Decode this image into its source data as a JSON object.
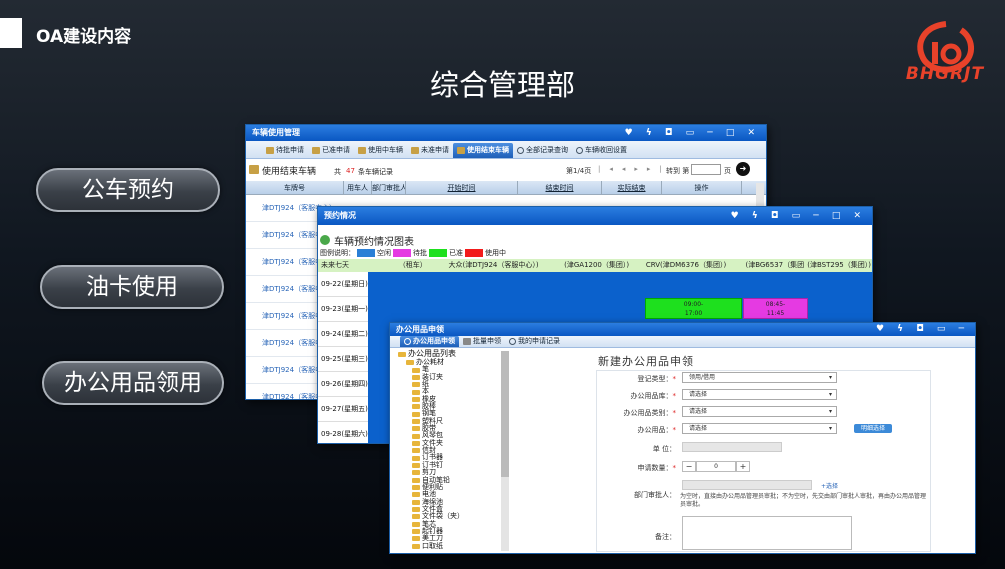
{
  "slide": {
    "section_title": "OA建设内容",
    "main_title": "综合管理部",
    "logo_text": "BHGRJT",
    "menu": [
      "公车预约",
      "油卡使用",
      "办公用品领用"
    ]
  },
  "vehicle_window": {
    "title": "车辆使用管理",
    "tabs": [
      "待批申请",
      "已准申请",
      "使用中车辆",
      "未准申请",
      "使用结束车辆",
      "全部记录查询",
      "车辆收回设置"
    ],
    "heading": "使用结束车辆",
    "count_prefix": "共",
    "count": "47",
    "count_suffix": "条车辆记录",
    "pager": {
      "page": "第1/4页",
      "goto": "转到 第",
      "unit": "页"
    },
    "columns": [
      "车牌号",
      "用车人",
      "部门审批人",
      "开始时间",
      "结束时间",
      "实际结束",
      "操作"
    ],
    "rows": [
      "津DTJ924（客服中心）",
      "津DTJ924（客服中心）",
      "津DTJ924（客服中心）",
      "津DTJ924（客服中心）",
      "津DTJ924（客服中心）",
      "津DTJ924（客服中心）",
      "津DTJ924（客服中心）",
      "津DTJ924（客服中心）"
    ]
  },
  "booking_window": {
    "title": "预约情况",
    "heading": "车辆预约情况图表",
    "legend_label": "图例说明：",
    "legend": [
      {
        "label": "空闲",
        "color": "#2a7fd6"
      },
      {
        "label": "待批",
        "color": "#e53ae2"
      },
      {
        "label": "已准",
        "color": "#1ee01e"
      },
      {
        "label": "使用中",
        "color": "#f21b1b"
      }
    ],
    "header": [
      "未来七天",
      "（租车）",
      "大众(津DTJ924（客服中心）)",
      "(津GA1200（集团）)",
      "CRV(津DM6376（集团）)",
      "(津BG6537（集团）)",
      "(津BST295（集团）)"
    ],
    "days": [
      "09-22(星期日)",
      "09-23(星期一)",
      "09-24(星期二)",
      "09-25(星期三)",
      "09-26(星期四)",
      "09-27(星期五)",
      "09-28(星期六)"
    ],
    "bookings": [
      {
        "time": "09:00-\n17:00",
        "color": "#1ee01e"
      },
      {
        "time": "08:45-\n11:45",
        "color": "#e53ae2"
      }
    ]
  },
  "supplies_window": {
    "title": "办公用品申领",
    "tabs": [
      "办公用品申领",
      "批量申领",
      "我的申请记录"
    ],
    "tree_root": "办公用品列表",
    "tree_group": "办公耗材",
    "tree_items": [
      "笔",
      "装订夹",
      "纸",
      "本",
      "橡皮",
      "胶棒",
      "钢笔",
      "塑料尺",
      "胶带",
      "风琴包",
      "文件夹",
      "信封",
      "订书器",
      "订书钉",
      "剪刀",
      "自动笔铅",
      "便利贴",
      "电池",
      "海绵池",
      "文件盒",
      "文件袋（夹）",
      "笔芯",
      "起钉器",
      "美工刀",
      "口取纸"
    ],
    "form_title": "新建办公用品申领",
    "fields": {
      "type_label": "登记类型：",
      "type_value": "领用/借用",
      "library_label": "办公用品库：",
      "library_value": "请选择",
      "category_label": "办公用品类别：",
      "category_value": "请选择",
      "item_label": "办公用品：",
      "item_value": "请选择",
      "detail_button": "明细选择",
      "unit_label": "单 位：",
      "qty_label": "申请数量：",
      "qty_value": "0",
      "approver_label": "部门审批人：",
      "approver_link": "+选择",
      "approver_note": "为空时，直接由办公用品管理员审批；不为空时，先交由部门审批人审批，再由办公用品管理员审批。",
      "remark_label": "备注："
    }
  },
  "colors": {
    "accent_blue": "#0a57c2",
    "logo_red": "#e8422a"
  }
}
